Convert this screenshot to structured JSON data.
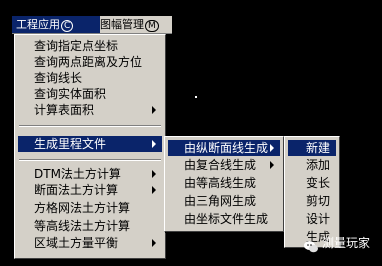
{
  "menubar": {
    "items": [
      {
        "label": "工程应用",
        "key": "C"
      },
      {
        "label": "图幅管理",
        "key": "M"
      }
    ]
  },
  "main_menu": {
    "items": [
      {
        "label": "查询指定点坐标"
      },
      {
        "label": "查询两点距离及方位"
      },
      {
        "label": "查询线长"
      },
      {
        "label": "查询实体面积"
      },
      {
        "label": "计算表面积"
      },
      {
        "label": "生成里程文件"
      },
      {
        "label": "DTM法土方计算"
      },
      {
        "label": "断面法土方计算"
      },
      {
        "label": "方格网法土方计算"
      },
      {
        "label": "等高线法土方计算"
      },
      {
        "label": "区域土方量平衡"
      }
    ]
  },
  "sub_menu": {
    "items": [
      {
        "label": "由纵断面线生成"
      },
      {
        "label": "由复合线生成"
      },
      {
        "label": "由等高线生成"
      },
      {
        "label": "由三角网生成"
      },
      {
        "label": "由坐标文件生成"
      }
    ]
  },
  "sub2_menu": {
    "items": [
      {
        "label": "新建"
      },
      {
        "label": "添加"
      },
      {
        "label": "变长"
      },
      {
        "label": "剪切"
      },
      {
        "label": "设计"
      },
      {
        "label": "生成"
      }
    ]
  },
  "watermark": {
    "text": "测量玩家",
    "icon": "wechat-icon"
  },
  "colors": {
    "background": "#000000",
    "menu": "#d4d0c8",
    "highlight": "#0a246a"
  }
}
